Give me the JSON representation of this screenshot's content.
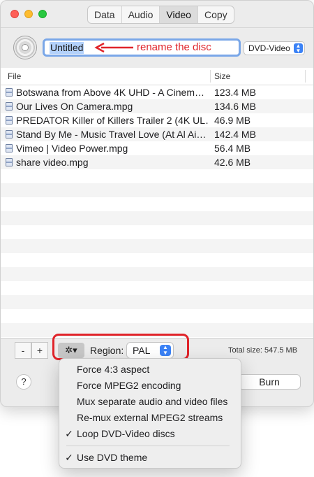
{
  "tabs": [
    "Data",
    "Audio",
    "Video",
    "Copy"
  ],
  "active_tab": "Video",
  "disc": {
    "name": "Untitled",
    "annotation": "rename the disc",
    "format": "DVD-Video"
  },
  "table": {
    "headers": {
      "file": "File",
      "size": "Size"
    },
    "rows": [
      {
        "name": "Botswana from Above 4K UHD - A Cinem…",
        "size": "123.4 MB"
      },
      {
        "name": "Our Lives On Camera.mpg",
        "size": "134.6 MB"
      },
      {
        "name": "PREDATOR Killer of Killers Trailer 2 (4K UL…",
        "size": "46.9 MB"
      },
      {
        "name": "Stand By Me - Music Travel Love (At Al Ai…",
        "size": "142.4 MB"
      },
      {
        "name": "Vimeo | Video Power.mpg",
        "size": "56.4 MB"
      },
      {
        "name": "share video.mpg",
        "size": "42.6 MB"
      }
    ]
  },
  "bottom": {
    "remove_label": "-",
    "add_label": "+",
    "gear_label": "✲▾",
    "region_label": "Region:",
    "region_value": "PAL",
    "total_size": "Total size: 547.5 MB",
    "help_label": "?",
    "burn_label": "Burn"
  },
  "menu": {
    "items": [
      {
        "label": "Force 4:3 aspect",
        "checked": ""
      },
      {
        "label": "Force MPEG2 encoding",
        "checked": ""
      },
      {
        "label": "Mux separate audio and video files",
        "checked": ""
      },
      {
        "label": "Re-mux external MPEG2 streams",
        "checked": ""
      },
      {
        "label": "Loop DVD-Video discs",
        "checked": "✓"
      },
      {
        "label": "Use DVD theme",
        "checked": "✓"
      }
    ]
  },
  "colors": {
    "annotation": "#e0242a",
    "accent": "#3b82f6",
    "selection": "#b3d1fb"
  }
}
